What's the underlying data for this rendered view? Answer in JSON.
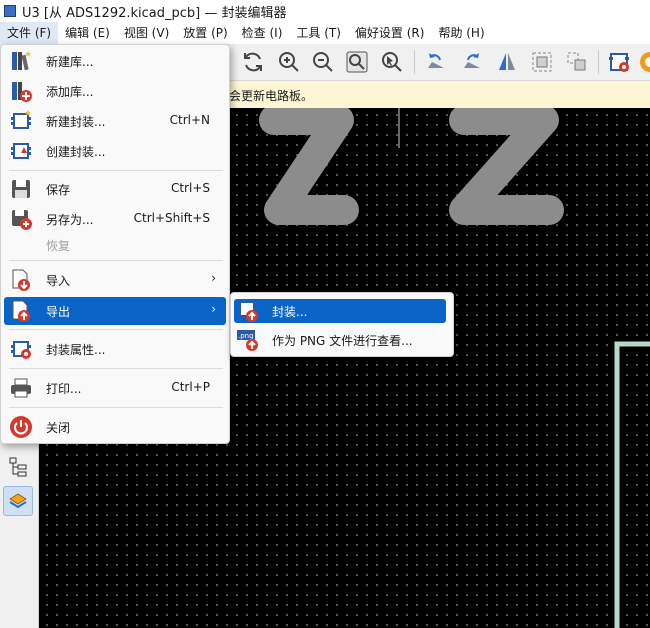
{
  "window": {
    "title": "U3 [从 ADS1292.kicad_pcb] — 封装编辑器"
  },
  "menubar": [
    {
      "label": "文件 (F)"
    },
    {
      "label": "编辑 (E)"
    },
    {
      "label": "视图 (V)"
    },
    {
      "label": "放置 (P)"
    },
    {
      "label": "检查 (I)"
    },
    {
      "label": "工具 (T)"
    },
    {
      "label": "偏好设置 (R)"
    },
    {
      "label": "帮助 (H)"
    }
  ],
  "infobar": {
    "text": "会更新电路板。"
  },
  "file_menu": {
    "items": [
      {
        "label": "新建库...",
        "icon": "new-library-icon",
        "shortcut": ""
      },
      {
        "label": "添加库...",
        "icon": "add-library-icon",
        "shortcut": ""
      },
      {
        "label": "新建封装...",
        "icon": "new-footprint-icon",
        "shortcut": "Ctrl+N"
      },
      {
        "label": "创建封装...",
        "icon": "create-footprint-icon",
        "shortcut": ""
      },
      {
        "label": "保存",
        "icon": "save-icon",
        "shortcut": "Ctrl+S"
      },
      {
        "label": "另存为...",
        "icon": "save-as-icon",
        "shortcut": "Ctrl+Shift+S"
      },
      {
        "label": "恢复",
        "icon": "",
        "shortcut": "",
        "disabled": true
      },
      {
        "label": "导入",
        "icon": "import-icon",
        "shortcut": "",
        "submenu_arrow": "›"
      },
      {
        "label": "导出",
        "icon": "export-icon",
        "shortcut": "",
        "submenu_arrow": "›",
        "highlighted": true
      },
      {
        "label": "封装属性...",
        "icon": "footprint-properties-icon",
        "shortcut": ""
      },
      {
        "label": "打印...",
        "icon": "print-icon",
        "shortcut": "Ctrl+P"
      },
      {
        "label": "关闭",
        "icon": "close-power-icon",
        "shortcut": ""
      }
    ]
  },
  "export_submenu": {
    "items": [
      {
        "label": "封装...",
        "icon": "export-footprint-icon",
        "highlighted": true
      },
      {
        "label": "作为 PNG 文件进行查看...",
        "icon": "export-png-icon",
        "badge": ".png"
      }
    ]
  },
  "colors": {
    "accent": "#0a64c8",
    "canvas_bg": "#000000",
    "silkscreen": "#8c8c8c",
    "board_outline": "#b7d8cc"
  }
}
